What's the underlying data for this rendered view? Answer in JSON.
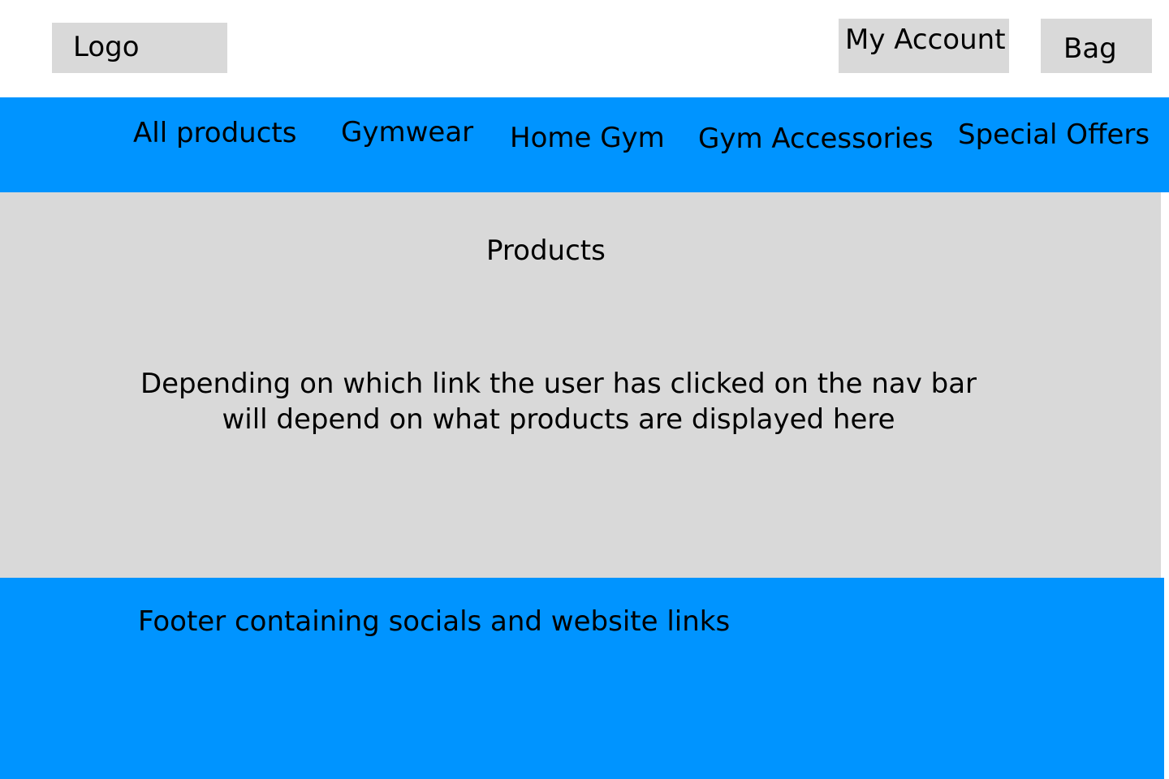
{
  "header": {
    "logo_label": "Logo",
    "account_label": "My Account",
    "bag_label": "Bag"
  },
  "nav": {
    "items": [
      {
        "label": "All products"
      },
      {
        "label": "Gymwear"
      },
      {
        "label": "Home Gym"
      },
      {
        "label": "Gym Accessories"
      },
      {
        "label": "Special Offers"
      }
    ]
  },
  "main": {
    "title": "Products",
    "description_lines": [
      "Depending on which link the user has clicked on the nav bar",
      "will depend on what products are displayed here"
    ]
  },
  "footer": {
    "text": "Footer containing socials and website links"
  },
  "colors": {
    "nav_background": "#0094ff",
    "footer_background": "#0094ff",
    "placeholder_gray": "#d9d9d9"
  }
}
